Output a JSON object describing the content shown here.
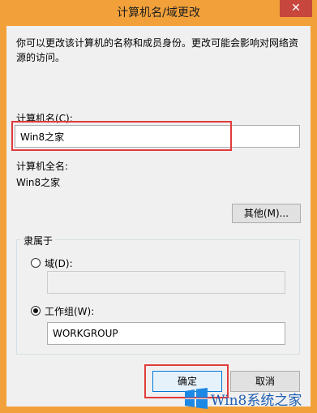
{
  "window": {
    "title": "计算机名/域更改",
    "close_glyph": "✕"
  },
  "description": "你可以更改该计算机的名称和成员身份。更改可能会影响对网络资源的访问。",
  "computer_name": {
    "label": "计算机名(C):",
    "value": "Win8之家"
  },
  "full_name": {
    "label": "计算机全名:",
    "value": "Win8之家"
  },
  "other_button": "其他(M)...",
  "member_of": {
    "legend": "隶属于",
    "domain": {
      "label": "域(D):",
      "value": "",
      "checked": false
    },
    "workgroup": {
      "label": "工作组(W):",
      "value": "WORKGROUP",
      "checked": true
    }
  },
  "buttons": {
    "ok": "确定",
    "cancel": "取消"
  },
  "watermark": {
    "text": "Win8系统之家",
    "logo": "windows-logo"
  },
  "colors": {
    "frame": "#F2A13A",
    "close": "#C7463D",
    "highlight": "#E23B3B",
    "watermark": "#1E5FB4"
  }
}
